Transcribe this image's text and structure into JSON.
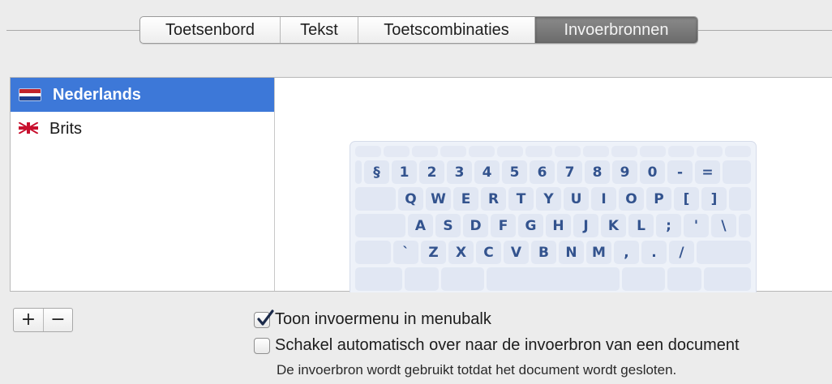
{
  "tabs": [
    "Toetsenbord",
    "Tekst",
    "Toetscombinaties",
    "Invoerbronnen"
  ],
  "selected_tab": "Invoerbronnen",
  "sources": [
    {
      "label": "Nederlands",
      "icon": "netherlands-flag-icon",
      "selected": true
    },
    {
      "label": "Brits",
      "icon": "uk-flag-icon",
      "selected": false
    }
  ],
  "keyboard": {
    "rows": [
      [
        "§",
        "1",
        "2",
        "3",
        "4",
        "5",
        "6",
        "7",
        "8",
        "9",
        "0",
        "-",
        "="
      ],
      [
        "Q",
        "W",
        "E",
        "R",
        "T",
        "Y",
        "U",
        "I",
        "O",
        "P",
        "[",
        "]"
      ],
      [
        "A",
        "S",
        "D",
        "F",
        "G",
        "H",
        "J",
        "K",
        "L",
        ";",
        "'",
        "\\"
      ],
      [
        "`",
        "Z",
        "X",
        "C",
        "V",
        "B",
        "N",
        "M",
        ",",
        ".",
        "/"
      ]
    ]
  },
  "buttons": {
    "add": "+",
    "remove": "−"
  },
  "options": {
    "show_menu": {
      "label": "Toon invoermenu in menubalk",
      "checked": true
    },
    "auto_switch": {
      "label": "Schakel automatisch over naar de invoerbron van een document",
      "checked": false
    },
    "hint": "De invoerbron wordt gebruikt totdat het document wordt gesloten."
  },
  "colors": {
    "selection": "#3d78d8",
    "key_text": "#33538e"
  }
}
